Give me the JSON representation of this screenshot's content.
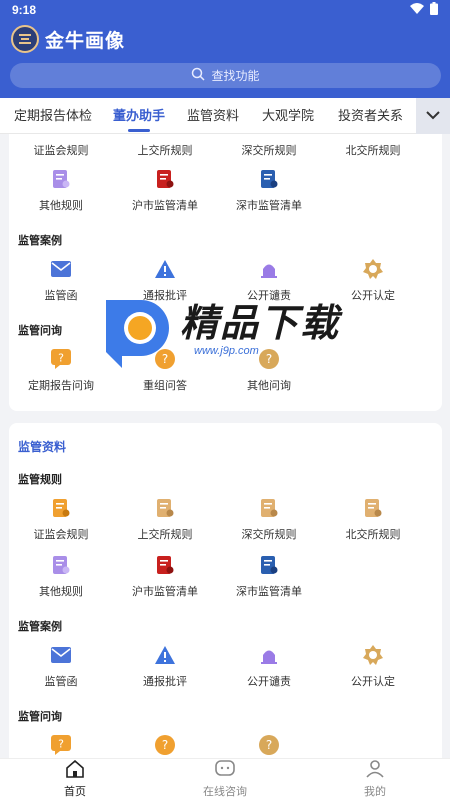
{
  "status": {
    "time": "9:18"
  },
  "app": {
    "name": "金牛画像"
  },
  "search": {
    "placeholder": "查找功能"
  },
  "tabs": [
    {
      "label": "定期报告体检"
    },
    {
      "label": "董办助手",
      "active": true
    },
    {
      "label": "监管资料"
    },
    {
      "label": "大观学院"
    },
    {
      "label": "投资者关系"
    }
  ],
  "card1": {
    "rows": [
      {
        "items": [
          "证监会规则",
          "上交所规则",
          "深交所规则",
          "北交所规则"
        ]
      },
      {
        "items": [
          {
            "label": "其他规则",
            "icon": "purple-doc-icon"
          },
          {
            "label": "沪市监管清单",
            "icon": "red-list-icon"
          },
          {
            "label": "深市监管清单",
            "icon": "blue-list-icon"
          }
        ]
      }
    ],
    "case_title": "监管案例",
    "cases": [
      {
        "label": "监管函",
        "icon": "envelope-icon"
      },
      {
        "label": "通报批评",
        "icon": "warning-icon"
      },
      {
        "label": "公开谴责",
        "icon": "alarm-icon"
      },
      {
        "label": "公开认定",
        "icon": "badge-icon"
      }
    ],
    "inquiry_title": "监管问询",
    "inquiries": [
      {
        "label": "定期报告问询",
        "icon": "question-chat-icon"
      },
      {
        "label": "重组问答",
        "icon": "question-circle-icon"
      },
      {
        "label": "其他问询",
        "icon": "question-circle-icon"
      }
    ]
  },
  "card2": {
    "title": "监管资料",
    "rules_title": "监管规则",
    "rules_row1": [
      {
        "label": "证监会规则",
        "icon": "orange-doc-icon"
      },
      {
        "label": "上交所规则",
        "icon": "orange-doc-icon"
      },
      {
        "label": "深交所规则",
        "icon": "orange-doc-icon"
      },
      {
        "label": "北交所规则",
        "icon": "orange-doc-icon"
      }
    ],
    "rules_row2": [
      {
        "label": "其他规则",
        "icon": "purple-doc-icon"
      },
      {
        "label": "沪市监管清单",
        "icon": "red-list-icon"
      },
      {
        "label": "深市监管清单",
        "icon": "blue-list-icon"
      }
    ],
    "case_title": "监管案例",
    "cases": [
      {
        "label": "监管函",
        "icon": "envelope-icon"
      },
      {
        "label": "通报批评",
        "icon": "warning-icon"
      },
      {
        "label": "公开谴责",
        "icon": "alarm-icon"
      },
      {
        "label": "公开认定",
        "icon": "badge-icon"
      }
    ],
    "inquiry_title": "监管问询"
  },
  "watermark": {
    "text": "精品下载",
    "url": "www.j9p.com"
  },
  "bottom_nav": [
    {
      "label": "首页",
      "active": true
    },
    {
      "label": "在线咨询"
    },
    {
      "label": "我的"
    }
  ],
  "colors": {
    "brand": "#3a5fd0",
    "orange": "#f0a030",
    "tan": "#e0b070",
    "purple": "#a98ee8",
    "red": "#c8201e",
    "blue": "#2a5fb0"
  }
}
